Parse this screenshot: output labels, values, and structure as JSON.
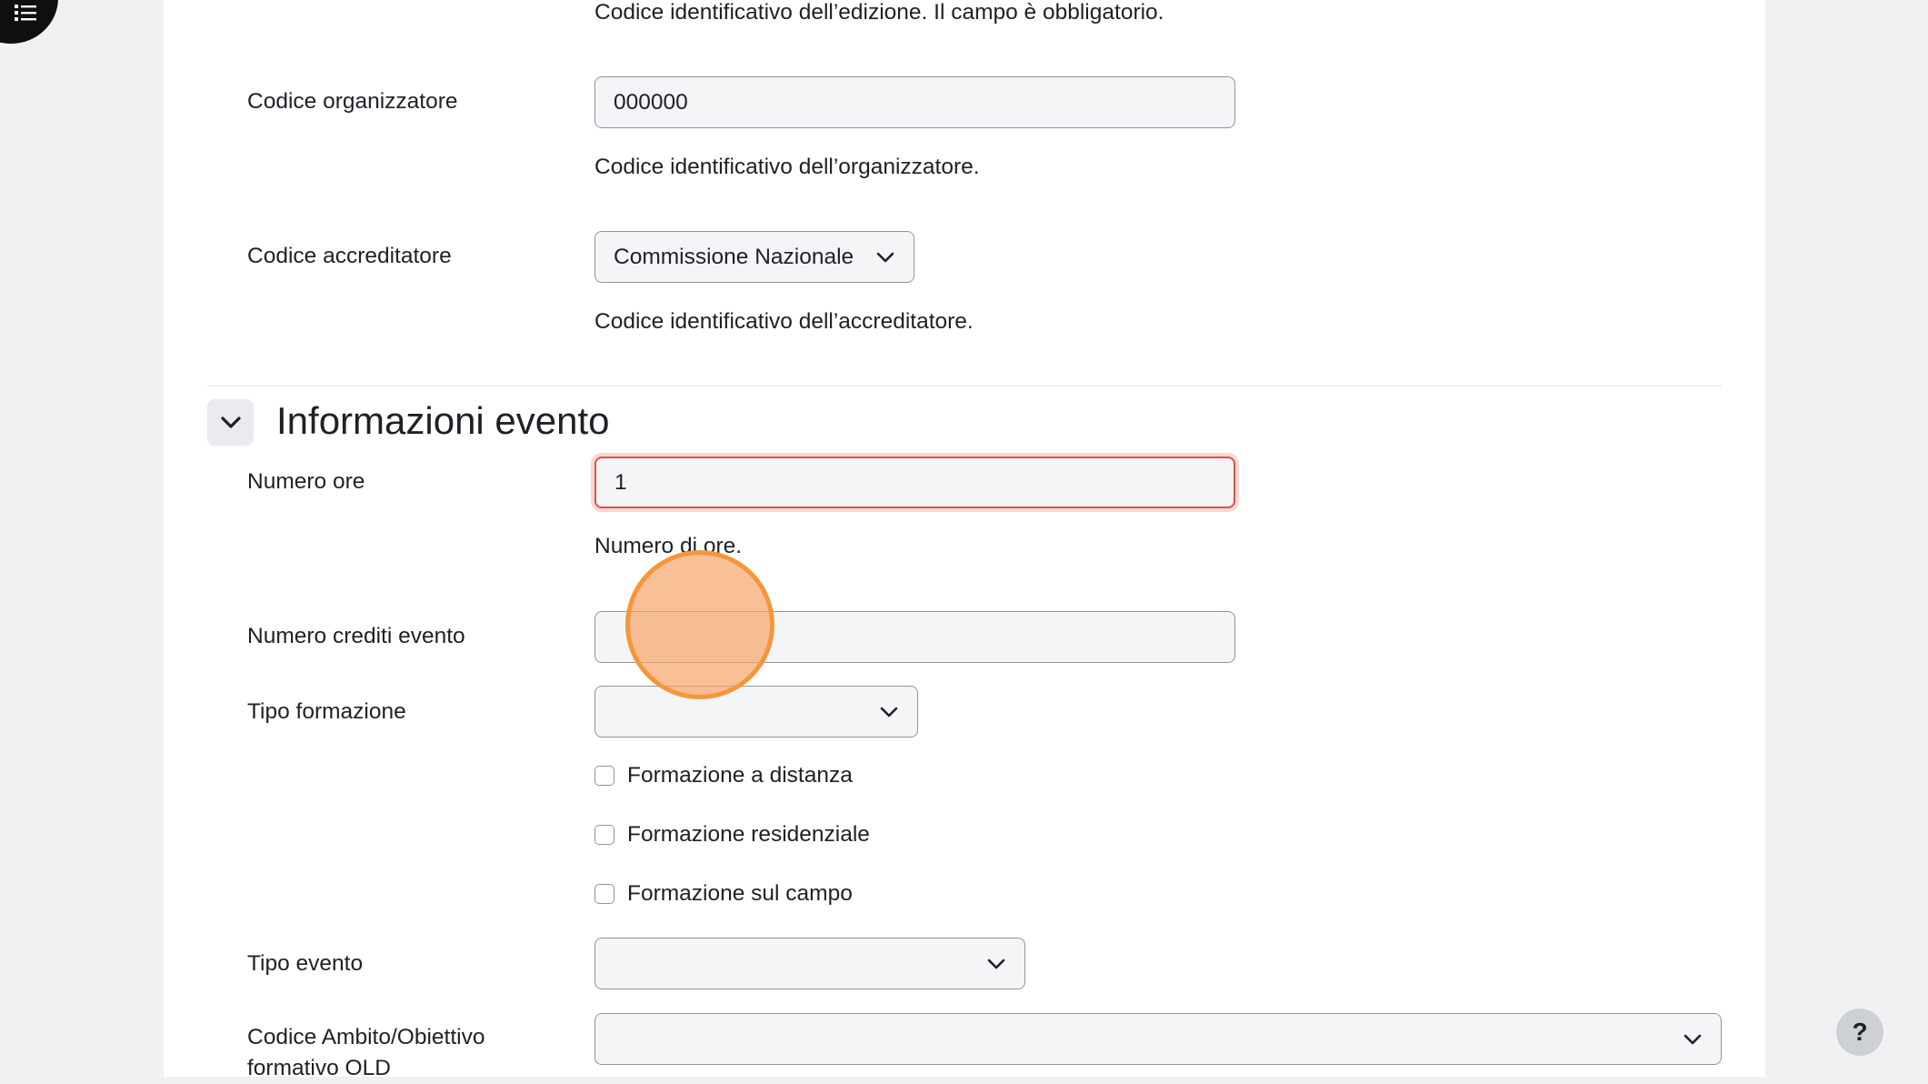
{
  "drawer": {
    "icon": "list-icon"
  },
  "fields": {
    "edizione_help": "Codice identificativo dell’edizione. Il campo è obbligatorio.",
    "organizzatore": {
      "label": "Codice organizzatore",
      "value": "000000",
      "help": "Codice identificativo dell’organizzatore."
    },
    "accreditatore": {
      "label": "Codice accreditatore",
      "value": "Commissione Nazionale",
      "help": "Codice identificativo dell’accreditatore."
    }
  },
  "section": {
    "title": "Informazioni evento",
    "toggle_icon": "chevron-down-icon"
  },
  "evento": {
    "numero_ore": {
      "label": "Numero ore",
      "value": "1",
      "help": "Numero di ore."
    },
    "numero_crediti": {
      "label": "Numero crediti evento",
      "value": ""
    },
    "tipo_formazione": {
      "label": "Tipo formazione",
      "value": "",
      "options": [
        "Formazione a distanza",
        "Formazione residenziale",
        "Formazione sul campo"
      ]
    },
    "tipo_evento": {
      "label": "Tipo evento",
      "value": ""
    },
    "codice_ambito": {
      "label_line1": "Codice Ambito/Obiettivo",
      "label_line2": "formativo OLD",
      "value": ""
    }
  },
  "help_button": {
    "label": "?"
  },
  "colors": {
    "invalid_border": "#d9534f",
    "cursor_highlight": "#f5963a"
  }
}
